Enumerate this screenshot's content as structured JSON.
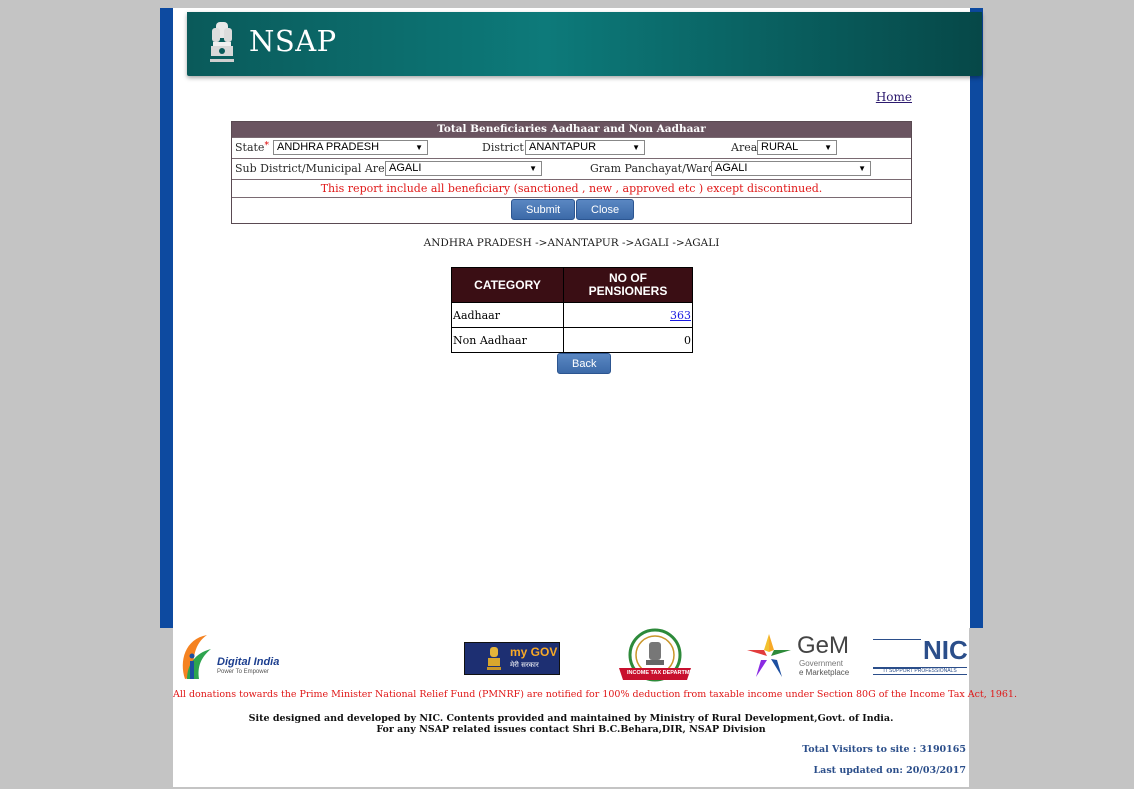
{
  "header": {
    "site_title": "NSAP",
    "emblem_caption": "सत्यमेव जयते"
  },
  "nav": {
    "home_label": "Home"
  },
  "filter_panel": {
    "title": "Total Beneficiaries Aadhaar and Non Aadhaar",
    "state_label": "State",
    "required_mark": "*",
    "state_value": "ANDHRA PRADESH",
    "district_label": "District",
    "district_value": "ANANTAPUR",
    "area_label": "Area",
    "area_value": "RURAL",
    "subdistrict_label": "Sub District/Municipal Area",
    "subdistrict_value": "AGALI",
    "gp_label": "Gram Panchayat/Ward",
    "gp_value": "AGALI",
    "notice": "This report include all beneficiary (sanctioned , new , approved etc ) except discontinued.",
    "submit_label": "Submit",
    "close_label": "Close"
  },
  "breadcrumb": "ANDHRA PRADESH ->ANANTAPUR ->AGALI ->AGALI",
  "results": {
    "col_category": "CATEGORY",
    "col_count_line1": "NO OF",
    "col_count_line2": "PENSIONERS",
    "rows": [
      {
        "category": "Aadhaar",
        "count": "363"
      },
      {
        "category": "Non Aadhaar",
        "count": "0"
      }
    ],
    "back_label": "Back"
  },
  "footer": {
    "digital_india": "Digital India",
    "digital_india_tag": "Power To Empower",
    "mygov": "my GOV",
    "mygov_hindi": "मेरी सरकार",
    "income_tax": "INCOME TAX DEPARTMENT",
    "gem_title": "GeM",
    "gem_line1": "Government",
    "gem_line2": "e Marketplace",
    "nic": "NIC",
    "nic_tag": "IT SUPPORT PROFESSIONALS",
    "donation_note": "All donations towards the Prime Minister National Relief Fund (PMNRF) are notified for 100% deduction from taxable income under Section 80G of the Income Tax Act, 1961.",
    "credits_line1": "Site designed and developed by NIC. Contents provided and maintained by Ministry of Rural Development,Govt. of India.",
    "credits_line2": "For any NSAP related issues contact Shri B.C.Behara,DIR, NSAP Division",
    "visitors": "Total Visitors to site : 3190165",
    "last_updated": "Last updated on: 20/03/2017"
  }
}
